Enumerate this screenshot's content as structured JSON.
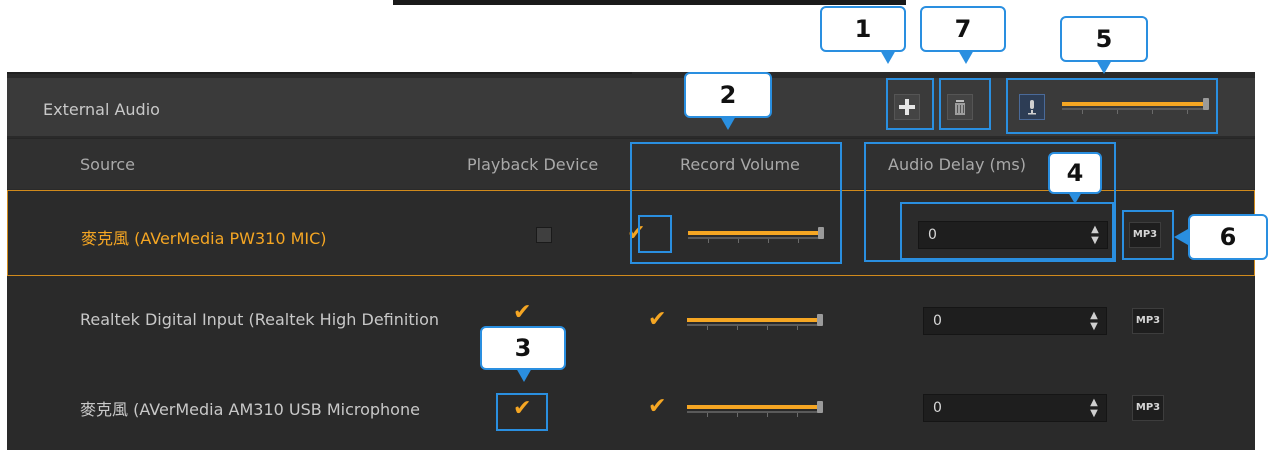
{
  "panel": {
    "title": "External Audio",
    "columns": {
      "source": "Source",
      "playback": "Playback Device",
      "record": "Record Volume",
      "delay": "Audio Delay (ms)"
    }
  },
  "toolbar": {
    "add_icon": "plus-icon",
    "delete_icon": "trash-icon",
    "mic_icon": "microphone-icon",
    "master_volume": 1.0
  },
  "rows": [
    {
      "name": "麥克風 (AVerMedia PW310 MIC)",
      "playback": false,
      "record": true,
      "volume": 1.0,
      "delay": "0",
      "mp3": "MP3",
      "selected": true
    },
    {
      "name": "Realtek Digital Input (Realtek High Definition",
      "playback": true,
      "record": true,
      "volume": 1.0,
      "delay": "0",
      "mp3": "MP3",
      "selected": false
    },
    {
      "name": "麥克風 (AVerMedia AM310 USB Microphone",
      "playback": true,
      "record": true,
      "volume": 1.0,
      "delay": "0",
      "mp3": "MP3",
      "selected": false
    }
  ],
  "callouts": {
    "c1": "1",
    "c2": "2",
    "c3": "3",
    "c4": "4",
    "c5": "5",
    "c6": "6",
    "c7": "7"
  },
  "colors": {
    "accent": "#f5a623",
    "highlight": "#2a8fe0",
    "panel": "#2a2a2a"
  }
}
